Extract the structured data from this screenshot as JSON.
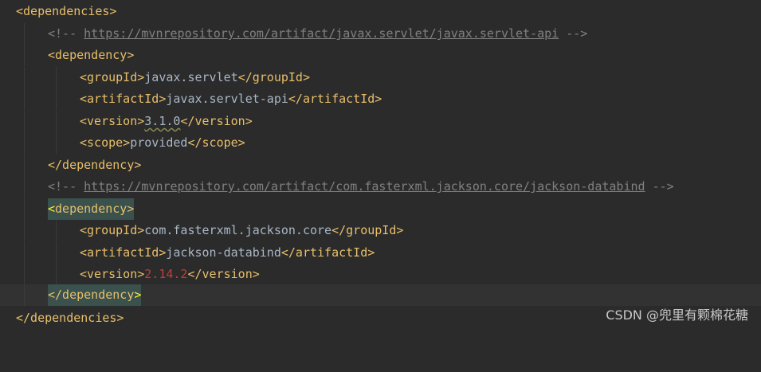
{
  "editor": {
    "lines": {
      "l1": {
        "open": "<dependencies>"
      },
      "l2": {
        "comment_open": "<!-- ",
        "url": "https://mvnrepository.com/artifact/javax.servlet/javax.servlet-api",
        "comment_close": " -->"
      },
      "l3": {
        "open": "<dependency>"
      },
      "l4": {
        "open": "<groupId>",
        "value": "javax.servlet",
        "close": "</groupId>"
      },
      "l5": {
        "open": "<artifactId>",
        "value": "javax.servlet-api",
        "close": "</artifactId>"
      },
      "l6": {
        "open": "<version>",
        "value": "3.1.0",
        "close": "</version>"
      },
      "l7": {
        "open": "<scope>",
        "value": "provided",
        "close": "</scope>"
      },
      "l8": {
        "close": "</dependency>"
      },
      "l9": {
        "comment_open": "<!-- ",
        "url": "https://mvnrepository.com/artifact/com.fasterxml.jackson.core/jackson-databind",
        "comment_close": " -->"
      },
      "l10": {
        "open_start": "<",
        "open_rest": "dependency>"
      },
      "l11": {
        "open": "<groupId>",
        "value": "com.fasterxml.jackson.core",
        "close": "</groupId>"
      },
      "l12": {
        "open": "<artifactId>",
        "value": "jackson-databind",
        "close": "</artifactId>"
      },
      "l13": {
        "open": "<version>",
        "value": "2.14.2",
        "close": "</version>"
      },
      "l14": {
        "close_main": "</dependency",
        "close_end": ">"
      },
      "l15": {
        "close": "</dependencies>"
      }
    },
    "colors": {
      "background": "#2b2b2b",
      "tag": "#e8bf6a",
      "text": "#a9b7c6",
      "comment": "#808080",
      "error_value": "#bc3f3c",
      "match_highlight": "#3b514d",
      "caret_bracket": "#ffef28"
    }
  },
  "watermark": {
    "text": "CSDN @兜里有颗棉花糖"
  }
}
